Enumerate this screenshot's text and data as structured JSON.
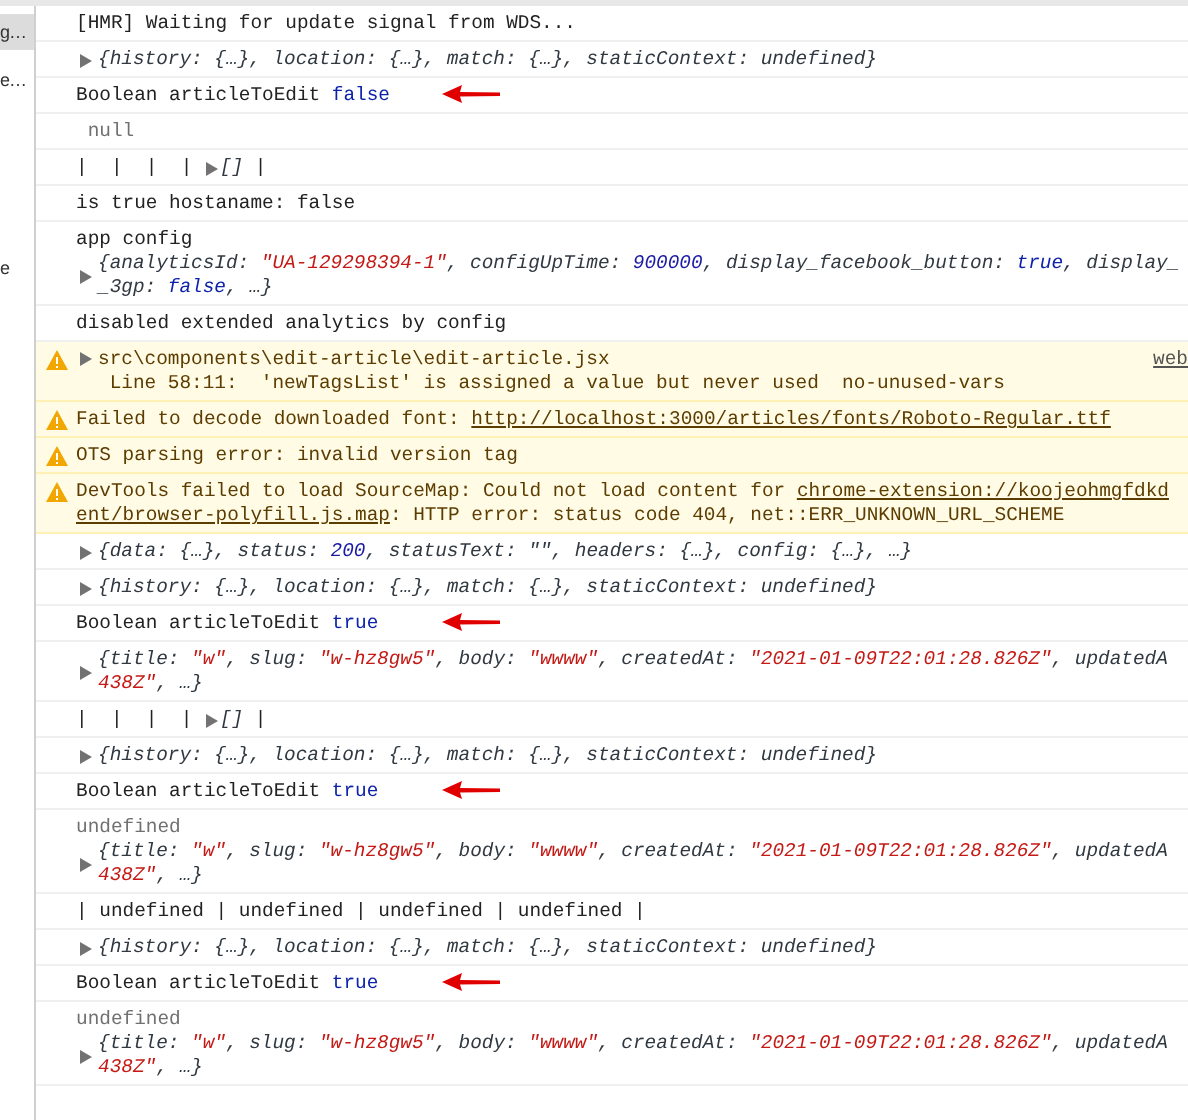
{
  "sidebar": {
    "items": [
      {
        "label": "g…",
        "selected": true
      },
      {
        "label": "e…",
        "selected": false
      },
      {
        "label": "e",
        "selected": false
      }
    ]
  },
  "console": [
    {
      "kind": "log",
      "arrow": false,
      "blocks": [
        {
          "toggle": false,
          "lines": [
            [
              {
                "kind": "text",
                "text": "[HMR] Waiting for update signal from WDS..."
              }
            ]
          ]
        }
      ]
    },
    {
      "kind": "log",
      "arrow": false,
      "blocks": [
        {
          "toggle": true,
          "lines": [
            [
              {
                "kind": "obj",
                "text": "{history: {…}, location: {…}, match: {…}, staticContext: undefined}"
              }
            ]
          ]
        }
      ]
    },
    {
      "kind": "log",
      "arrow": true,
      "blocks": [
        {
          "toggle": false,
          "lines": [
            [
              {
                "kind": "text",
                "text": "Boolean articleToEdit "
              },
              {
                "kind": "kw",
                "text": "false"
              }
            ]
          ]
        }
      ]
    },
    {
      "kind": "log",
      "arrow": false,
      "blocks": [
        {
          "toggle": false,
          "lines": [
            [
              {
                "kind": "dim",
                "text": " null"
              }
            ]
          ]
        }
      ]
    },
    {
      "kind": "log",
      "arrow": false,
      "blocks": [
        {
          "toggle": false,
          "lines": [
            [
              {
                "kind": "text",
                "text": "|  |  |  | "
              },
              {
                "kind": "toggle"
              },
              {
                "kind": "obj",
                "text": "[]"
              },
              {
                "kind": "text",
                "text": " |"
              }
            ]
          ]
        }
      ]
    },
    {
      "kind": "log",
      "arrow": false,
      "blocks": [
        {
          "toggle": false,
          "lines": [
            [
              {
                "kind": "text",
                "text": "is true hostaname: false"
              }
            ]
          ]
        }
      ]
    },
    {
      "kind": "log",
      "arrow": false,
      "blocks": [
        {
          "toggle": false,
          "lines": [
            [
              {
                "kind": "text",
                "text": "app config"
              }
            ]
          ]
        },
        {
          "toggle": true,
          "lines": [
            [
              {
                "kind": "obj",
                "text": "{analyticsId: "
              },
              {
                "kind": "str",
                "text": "\"UA-129298394-1\""
              },
              {
                "kind": "obj",
                "text": ", configUpTime: "
              },
              {
                "kind": "num",
                "text": "900000"
              },
              {
                "kind": "obj",
                "text": ", display_facebook_button: "
              },
              {
                "kind": "kwi",
                "text": "true"
              },
              {
                "kind": "obj",
                "text": ", display_"
              }
            ],
            [
              {
                "kind": "obj",
                "text": "_3gp: "
              },
              {
                "kind": "kwi",
                "text": "false"
              },
              {
                "kind": "obj",
                "text": ", …}"
              }
            ]
          ]
        }
      ]
    },
    {
      "kind": "log",
      "arrow": false,
      "blocks": [
        {
          "toggle": false,
          "lines": [
            [
              {
                "kind": "text",
                "text": "disabled extended analytics by config"
              }
            ]
          ]
        }
      ]
    },
    {
      "kind": "warning",
      "arrow": false,
      "source": "web",
      "blocks": [
        {
          "toggle": true,
          "lines": [
            [
              {
                "kind": "text",
                "text": "src\\components\\edit-article\\edit-article.jsx"
              }
            ],
            [
              {
                "kind": "text",
                "text": " Line 58:11:  'newTagsList' is assigned a value but never used  no-unused-vars"
              }
            ]
          ]
        }
      ]
    },
    {
      "kind": "warning",
      "arrow": false,
      "blocks": [
        {
          "toggle": false,
          "lines": [
            [
              {
                "kind": "text",
                "text": "Failed to decode downloaded font: "
              },
              {
                "kind": "link",
                "text": "http://localhost:3000/articles/fonts/Roboto-Regular.ttf"
              }
            ]
          ]
        }
      ]
    },
    {
      "kind": "warning",
      "arrow": false,
      "blocks": [
        {
          "toggle": false,
          "lines": [
            [
              {
                "kind": "text",
                "text": "OTS parsing error: invalid version tag"
              }
            ]
          ]
        }
      ]
    },
    {
      "kind": "warning",
      "arrow": false,
      "blocks": [
        {
          "toggle": false,
          "lines": [
            [
              {
                "kind": "text",
                "text": "DevTools failed to load SourceMap: Could not load content for "
              },
              {
                "kind": "link",
                "text": "chrome-extension://koojeohmgfdkd"
              }
            ],
            [
              {
                "kind": "link",
                "text": "ent/browser-polyfill.js.map"
              },
              {
                "kind": "text",
                "text": ": HTTP error: status code 404, net::ERR_UNKNOWN_URL_SCHEME"
              }
            ]
          ]
        }
      ]
    },
    {
      "kind": "log",
      "arrow": false,
      "blocks": [
        {
          "toggle": true,
          "lines": [
            [
              {
                "kind": "obj",
                "text": "{data: {…}, status: "
              },
              {
                "kind": "num",
                "text": "200"
              },
              {
                "kind": "obj",
                "text": ", statusText: \"\", headers: {…}, config: {…}, …}"
              }
            ]
          ]
        }
      ]
    },
    {
      "kind": "log",
      "arrow": false,
      "blocks": [
        {
          "toggle": true,
          "lines": [
            [
              {
                "kind": "obj",
                "text": "{history: {…}, location: {…}, match: {…}, staticContext: undefined}"
              }
            ]
          ]
        }
      ]
    },
    {
      "kind": "log",
      "arrow": true,
      "blocks": [
        {
          "toggle": false,
          "lines": [
            [
              {
                "kind": "text",
                "text": "Boolean articleToEdit "
              },
              {
                "kind": "kw",
                "text": "true"
              }
            ]
          ]
        }
      ]
    },
    {
      "kind": "log",
      "arrow": false,
      "blocks": [
        {
          "toggle": true,
          "lines": [
            [
              {
                "kind": "obj",
                "text": "{title: "
              },
              {
                "kind": "str",
                "text": "\"w\""
              },
              {
                "kind": "obj",
                "text": ", slug: "
              },
              {
                "kind": "str",
                "text": "\"w-hz8gw5\""
              },
              {
                "kind": "obj",
                "text": ", body: "
              },
              {
                "kind": "str",
                "text": "\"wwww\""
              },
              {
                "kind": "obj",
                "text": ", createdAt: "
              },
              {
                "kind": "str",
                "text": "\"2021-01-09T22:01:28.826Z\""
              },
              {
                "kind": "obj",
                "text": ", updatedA"
              }
            ],
            [
              {
                "kind": "str",
                "text": "438Z\""
              },
              {
                "kind": "obj",
                "text": ", …}"
              }
            ]
          ]
        }
      ]
    },
    {
      "kind": "log",
      "arrow": false,
      "blocks": [
        {
          "toggle": false,
          "lines": [
            [
              {
                "kind": "text",
                "text": "|  |  |  | "
              },
              {
                "kind": "toggle"
              },
              {
                "kind": "obj",
                "text": "[]"
              },
              {
                "kind": "text",
                "text": " |"
              }
            ]
          ]
        }
      ]
    },
    {
      "kind": "log",
      "arrow": false,
      "blocks": [
        {
          "toggle": true,
          "lines": [
            [
              {
                "kind": "obj",
                "text": "{history: {…}, location: {…}, match: {…}, staticContext: undefined}"
              }
            ]
          ]
        }
      ]
    },
    {
      "kind": "log",
      "arrow": true,
      "blocks": [
        {
          "toggle": false,
          "lines": [
            [
              {
                "kind": "text",
                "text": "Boolean articleToEdit "
              },
              {
                "kind": "kw",
                "text": "true"
              }
            ]
          ]
        }
      ]
    },
    {
      "kind": "log",
      "arrow": false,
      "blocks": [
        {
          "toggle": false,
          "lines": [
            [
              {
                "kind": "dim",
                "text": "undefined"
              }
            ]
          ]
        },
        {
          "toggle": true,
          "lines": [
            [
              {
                "kind": "obj",
                "text": "{title: "
              },
              {
                "kind": "str",
                "text": "\"w\""
              },
              {
                "kind": "obj",
                "text": ", slug: "
              },
              {
                "kind": "str",
                "text": "\"w-hz8gw5\""
              },
              {
                "kind": "obj",
                "text": ", body: "
              },
              {
                "kind": "str",
                "text": "\"wwww\""
              },
              {
                "kind": "obj",
                "text": ", createdAt: "
              },
              {
                "kind": "str",
                "text": "\"2021-01-09T22:01:28.826Z\""
              },
              {
                "kind": "obj",
                "text": ", updatedA"
              }
            ],
            [
              {
                "kind": "str",
                "text": "438Z\""
              },
              {
                "kind": "obj",
                "text": ", …}"
              }
            ]
          ]
        }
      ]
    },
    {
      "kind": "log",
      "arrow": false,
      "blocks": [
        {
          "toggle": false,
          "lines": [
            [
              {
                "kind": "text",
                "text": "| undefined | undefined | undefined | undefined |"
              }
            ]
          ]
        }
      ]
    },
    {
      "kind": "log",
      "arrow": false,
      "blocks": [
        {
          "toggle": true,
          "lines": [
            [
              {
                "kind": "obj",
                "text": "{history: {…}, location: {…}, match: {…}, staticContext: undefined}"
              }
            ]
          ]
        }
      ]
    },
    {
      "kind": "log",
      "arrow": true,
      "blocks": [
        {
          "toggle": false,
          "lines": [
            [
              {
                "kind": "text",
                "text": "Boolean articleToEdit "
              },
              {
                "kind": "kw",
                "text": "true"
              }
            ]
          ]
        }
      ]
    },
    {
      "kind": "log",
      "arrow": false,
      "blocks": [
        {
          "toggle": false,
          "lines": [
            [
              {
                "kind": "dim",
                "text": "undefined"
              }
            ]
          ]
        },
        {
          "toggle": true,
          "lines": [
            [
              {
                "kind": "obj",
                "text": "{title: "
              },
              {
                "kind": "str",
                "text": "\"w\""
              },
              {
                "kind": "obj",
                "text": ", slug: "
              },
              {
                "kind": "str",
                "text": "\"w-hz8gw5\""
              },
              {
                "kind": "obj",
                "text": ", body: "
              },
              {
                "kind": "str",
                "text": "\"wwww\""
              },
              {
                "kind": "obj",
                "text": ", createdAt: "
              },
              {
                "kind": "str",
                "text": "\"2021-01-09T22:01:28.826Z\""
              },
              {
                "kind": "obj",
                "text": ", updatedA"
              }
            ],
            [
              {
                "kind": "str",
                "text": "438Z\""
              },
              {
                "kind": "obj",
                "text": ", …}"
              }
            ]
          ]
        }
      ]
    }
  ]
}
